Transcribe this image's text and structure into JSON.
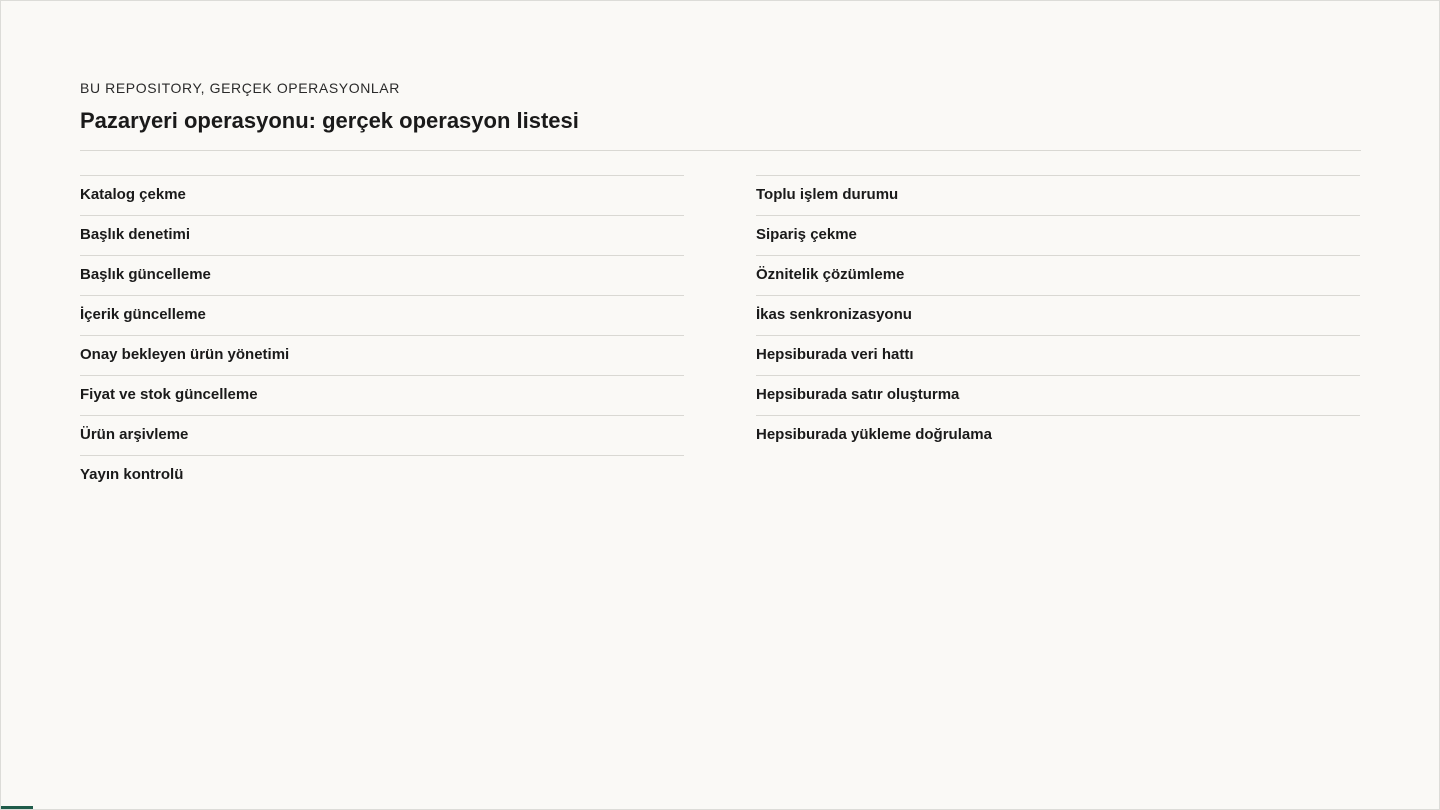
{
  "header": {
    "eyebrow": "BU REPOSITORY, GERÇEK OPERASYONLAR",
    "title": "Pazaryeri operasyonu: gerçek operasyon listesi"
  },
  "operations": {
    "left": [
      "Katalog çekme",
      "Başlık denetimi",
      "Başlık güncelleme",
      "İçerik güncelleme",
      "Onay bekleyen ürün yönetimi",
      "Fiyat ve stok güncelleme",
      "Ürün arşivleme",
      "Yayın kontrolü"
    ],
    "right": [
      "Toplu işlem durumu",
      "Sipariş çekme",
      "Öznitelik çözümleme",
      "İkas senkronizasyonu",
      "Hepsiburada veri hattı",
      "Hepsiburada satır oluşturma",
      "Hepsiburada yükleme doğrulama"
    ]
  },
  "theme": {
    "background": "#faf9f6",
    "rule": "#d9d8d3",
    "accent": "#1f5c4a",
    "text": "#1a1a1a"
  }
}
